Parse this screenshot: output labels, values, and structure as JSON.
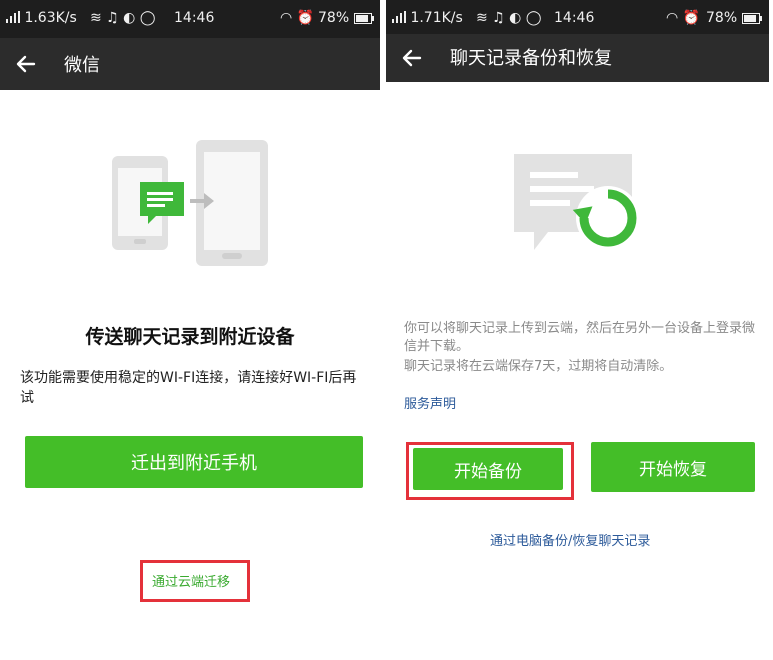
{
  "left": {
    "status": {
      "speed": "1.63K/s",
      "time": "14:46",
      "battery": "78%"
    },
    "appbar": {
      "title": "微信"
    },
    "heading": "传送聊天记录到附近设备",
    "description": "该功能需要使用稳定的WI-FI连接，请连接好WI-FI后再试",
    "primary_button": "迁出到附近手机",
    "cloud_link": "通过云端迁移"
  },
  "right": {
    "status": {
      "speed": "1.71K/s",
      "time": "14:46",
      "battery": "78%"
    },
    "appbar": {
      "title": "聊天记录备份和恢复"
    },
    "description_line1": "你可以将聊天记录上传到云端，然后在另外一台设备上登录微信并下载。",
    "description_line2": "聊天记录将在云端保存7天，过期将自动清除。",
    "service_link": "服务声明",
    "backup_button": "开始备份",
    "restore_button": "开始恢复",
    "pc_link": "通过电脑备份/恢复聊天记录"
  },
  "colors": {
    "wechat_green": "#44be28",
    "highlight_red": "#e4313a",
    "link_blue": "#2c5a9a",
    "link_green": "#3aaa30"
  }
}
